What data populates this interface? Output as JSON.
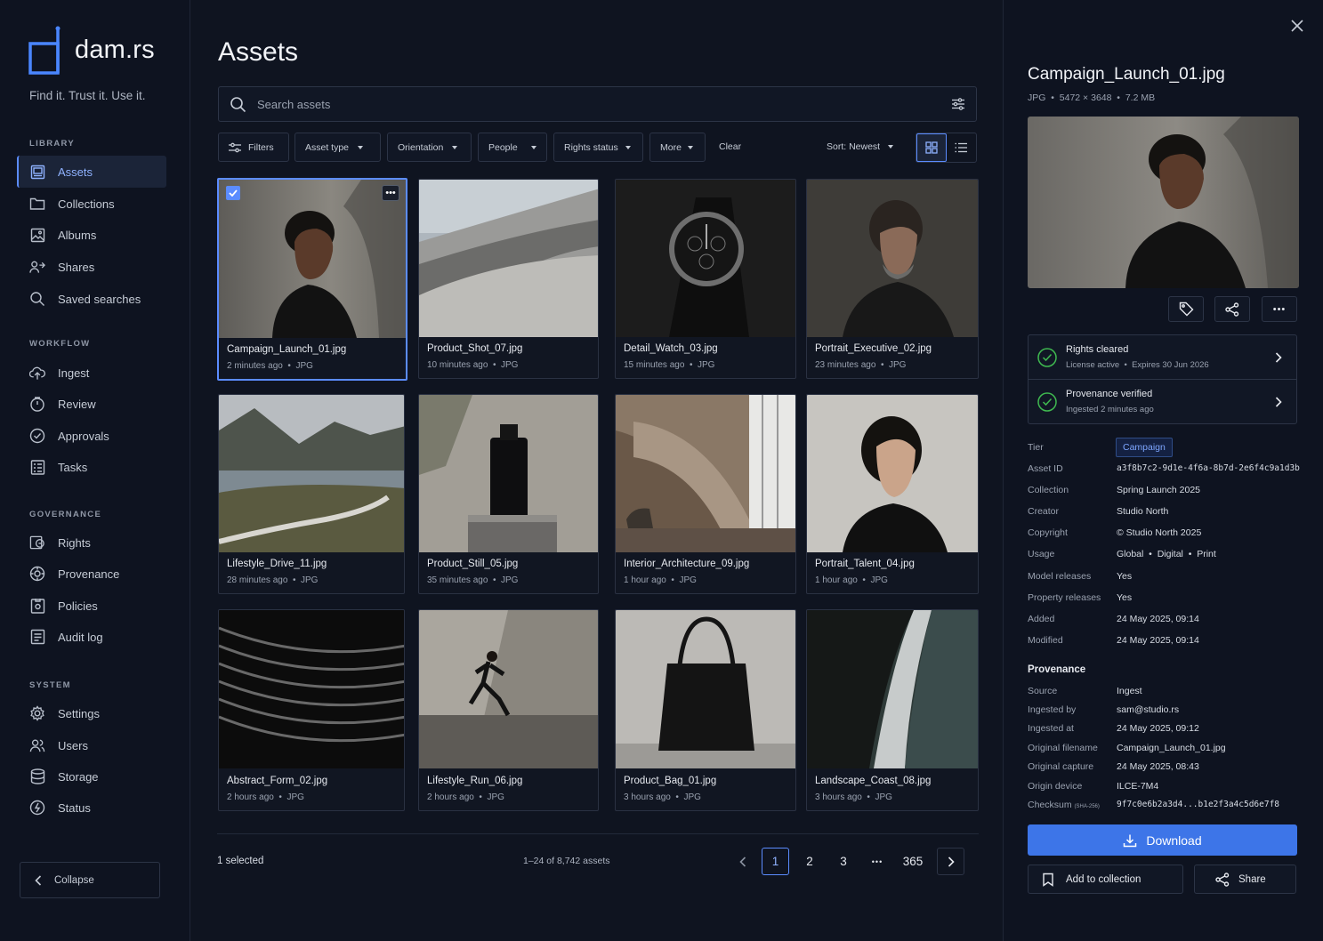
{
  "brand": {
    "name": "dam.rs",
    "tagline": "Find it. Trust it. Use it."
  },
  "sidebar": {
    "sections": [
      {
        "label": "LIBRARY",
        "items": [
          {
            "label": "Assets",
            "icon": "assets-icon",
            "active": true
          },
          {
            "label": "Collections",
            "icon": "folder-icon"
          },
          {
            "label": "Albums",
            "icon": "image-icon"
          },
          {
            "label": "Shares",
            "icon": "shares-icon"
          },
          {
            "label": "Saved searches",
            "icon": "search-icon"
          }
        ]
      },
      {
        "label": "WORKFLOW",
        "items": [
          {
            "label": "Ingest",
            "icon": "cloud-upload-icon"
          },
          {
            "label": "Review",
            "icon": "review-icon"
          },
          {
            "label": "Approvals",
            "icon": "check-circle-icon"
          },
          {
            "label": "Tasks",
            "icon": "tasks-icon"
          }
        ]
      },
      {
        "label": "GOVERNANCE",
        "items": [
          {
            "label": "Rights",
            "icon": "rights-icon"
          },
          {
            "label": "Provenance",
            "icon": "provenance-icon"
          },
          {
            "label": "Policies",
            "icon": "policies-icon"
          },
          {
            "label": "Audit log",
            "icon": "audit-log-icon"
          }
        ]
      },
      {
        "label": "SYSTEM",
        "items": [
          {
            "label": "Settings",
            "icon": "gear-icon"
          },
          {
            "label": "Users",
            "icon": "users-icon"
          },
          {
            "label": "Storage",
            "icon": "database-icon"
          },
          {
            "label": "Status",
            "icon": "status-icon"
          }
        ]
      }
    ],
    "collapse_label": "Collapse"
  },
  "main": {
    "title": "Assets",
    "search_placeholder": "Search assets",
    "filters": {
      "filters_label": "Filters",
      "asset_type": "Asset type",
      "orientation": "Orientation",
      "people": "People",
      "rights_status": "Rights status",
      "more": "More",
      "clear": "Clear",
      "sort": "Sort: Newest"
    },
    "view_mode": "grid",
    "assets": [
      {
        "name": "Campaign_Launch_01.jpg",
        "age": "2 minutes ago",
        "type": "JPG",
        "selected": true
      },
      {
        "name": "Product_Shot_07.jpg",
        "age": "10 minutes ago",
        "type": "JPG"
      },
      {
        "name": "Detail_Watch_03.jpg",
        "age": "15 minutes ago",
        "type": "JPG"
      },
      {
        "name": "Portrait_Executive_02.jpg",
        "age": "23 minutes ago",
        "type": "JPG"
      },
      {
        "name": "Lifestyle_Drive_11.jpg",
        "age": "28 minutes ago",
        "type": "JPG"
      },
      {
        "name": "Product_Still_05.jpg",
        "age": "35 minutes ago",
        "type": "JPG"
      },
      {
        "name": "Interior_Architecture_09.jpg",
        "age": "1 hour ago",
        "type": "JPG"
      },
      {
        "name": "Portrait_Talent_04.jpg",
        "age": "1 hour ago",
        "type": "JPG"
      },
      {
        "name": "Abstract_Form_02.jpg",
        "age": "2 hours ago",
        "type": "JPG"
      },
      {
        "name": "Lifestyle_Run_06.jpg",
        "age": "2 hours ago",
        "type": "JPG"
      },
      {
        "name": "Product_Bag_01.jpg",
        "age": "3 hours ago",
        "type": "JPG"
      },
      {
        "name": "Landscape_Coast_08.jpg",
        "age": "3 hours ago",
        "type": "JPG"
      }
    ],
    "selected_count": "1 selected",
    "range_text": "1–24 of 8,742 assets",
    "pagination": {
      "pages": [
        "1",
        "2",
        "3"
      ],
      "ellipsis": "•••",
      "last": "365",
      "current": "1"
    }
  },
  "details": {
    "title": "Campaign_Launch_01.jpg",
    "format": "JPG",
    "dimensions": "5472 × 3648",
    "size": "7.2 MB",
    "rights": {
      "title": "Rights cleared",
      "license": "License active",
      "expires": "Expires 30 Jun 2026"
    },
    "provenance_status": {
      "title": "Provenance verified",
      "sub": "Ingested 2 minutes ago"
    },
    "meta": [
      {
        "key": "Tier",
        "value": "Campaign"
      },
      {
        "key": "Asset ID",
        "value": "a3f8b7c2-9d1e-4f6a-8b7d-2e6f4c9a1d3b"
      },
      {
        "key": "Collection",
        "value": "Spring Launch 2025"
      },
      {
        "key": "Creator",
        "value": "Studio North"
      },
      {
        "key": "Copyright",
        "value": "© Studio North 2025"
      },
      {
        "key": "Usage",
        "value": "Global  •  Digital  •  Print"
      },
      {
        "key": "Model releases",
        "value": "Yes"
      },
      {
        "key": "Property releases",
        "value": "Yes"
      },
      {
        "key": "Added",
        "value": "24 May 2025, 09:14"
      },
      {
        "key": "Modified",
        "value": "24 May 2025, 09:14"
      }
    ],
    "provenance_heading": "Provenance",
    "provenance": [
      {
        "key": "Source",
        "value": "Ingest"
      },
      {
        "key": "Ingested by",
        "value": "sam@studio.rs"
      },
      {
        "key": "Ingested at",
        "value": "24 May 2025, 09:12"
      },
      {
        "key": "Original filename",
        "value": "Campaign_Launch_01.jpg"
      },
      {
        "key": "Original capture",
        "value": "24 May 2025, 08:43"
      },
      {
        "key": "Origin device",
        "value": "ILCE-7M4"
      },
      {
        "key": "Checksum",
        "key_suffix": "(SHA-256)",
        "value": "9f7c0e6b2a3d4...b1e2f3a4c5d6e7f8"
      }
    ],
    "download_label": "Download",
    "add_to_collection_label": "Add to collection",
    "share_label": "Share"
  },
  "colors": {
    "accent": "#5b8cff",
    "download": "#3d75e8",
    "background": "#0f1420",
    "success": "#3fb950"
  }
}
